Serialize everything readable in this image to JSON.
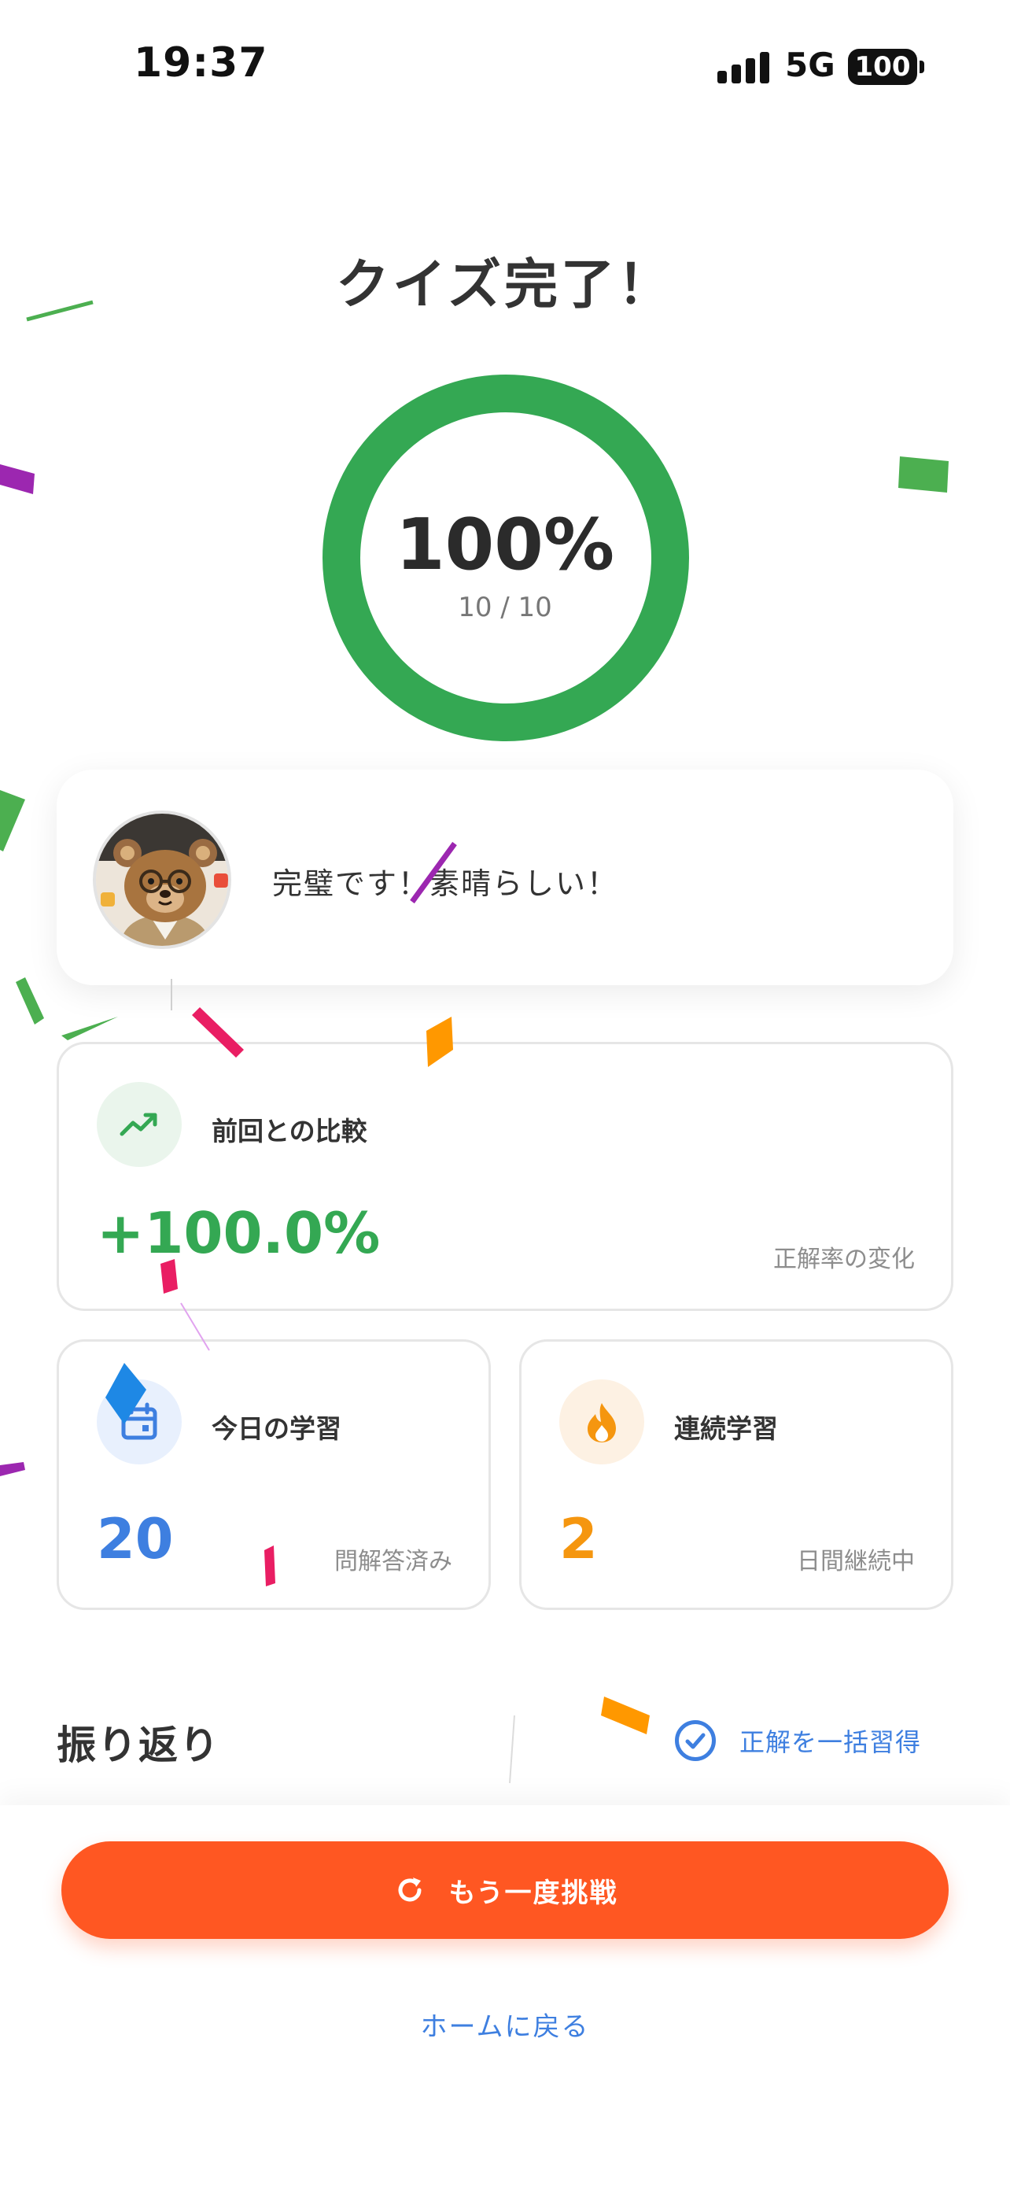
{
  "status": {
    "time": "19:37",
    "network": "5G",
    "battery": "100"
  },
  "title": "クイズ完了！",
  "score": {
    "percent": "100%",
    "fraction": "10 / 10",
    "progress": 1.0
  },
  "message": "完璧です！素晴らしい！",
  "compare": {
    "label": "前回との比較",
    "value": "+100.0%",
    "note": "正解率の変化"
  },
  "today": {
    "label": "今日の学習",
    "value": "20",
    "note": "問解答済み"
  },
  "streak": {
    "label": "連続学習",
    "value": "2",
    "note": "日間継続中"
  },
  "review": {
    "title": "振り返り",
    "bulk_label": "正解を一括習得"
  },
  "actions": {
    "retry_label": "もう一度挑戦",
    "home_label": "ホームに戻る"
  },
  "colors": {
    "green": "#34a853",
    "blue": "#3e7fe0",
    "orange": "#f5960f",
    "cta": "#ff5722"
  }
}
